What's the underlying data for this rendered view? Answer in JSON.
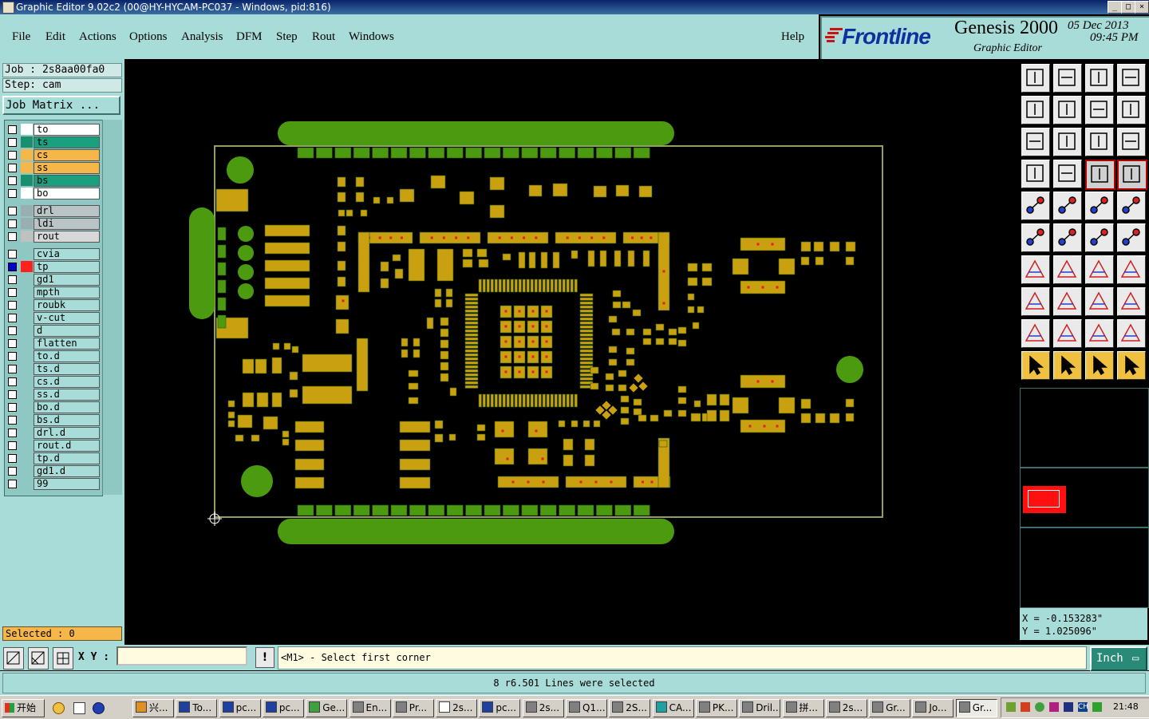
{
  "window": {
    "title": "Graphic Editor 9.02c2 (00@HY-HYCAM-PC037 - Windows, pid:816)",
    "controls": [
      "_",
      "□",
      "×"
    ]
  },
  "menu": [
    "File",
    "Edit",
    "Actions",
    "Options",
    "Analysis",
    "DFM",
    "Step",
    "Rout",
    "Windows"
  ],
  "help": "Help",
  "brand": {
    "logo": "Frontline",
    "product": "Genesis 2000",
    "subtitle": "Graphic Editor",
    "date": "05 Dec 2013",
    "time": "09:45 PM"
  },
  "job": {
    "job_line": "Job : 2s8aa00fa0",
    "step_line": "Step: cam",
    "matrix_button": "Job Matrix ..."
  },
  "layers": [
    {
      "name": "to",
      "color": "#ffffff",
      "name_bg": "#ffffff"
    },
    {
      "name": "ts",
      "color": "#1a8f6f",
      "name_bg": "#1a9f7f"
    },
    {
      "name": "cs",
      "color": "#f5b64a",
      "name_bg": "#f5b64a"
    },
    {
      "name": "ss",
      "color": "#f5b64a",
      "name_bg": "#f5b64a"
    },
    {
      "name": "bs",
      "color": "#1a8f6f",
      "name_bg": "#1a9f7f"
    },
    {
      "name": "bo",
      "color": "#ffffff",
      "name_bg": "#ffffff"
    },
    {
      "name": "drl",
      "color": "#9aaeb0",
      "name_bg": "#b8c4c6"
    },
    {
      "name": "ldi",
      "color": "#9aaeb0",
      "name_bg": "#b8c4c6"
    },
    {
      "name": "rout",
      "color": "#c0c0c0",
      "name_bg": "#d8d8d8"
    },
    {
      "name": "cvia",
      "color": "#8fc7c3",
      "name_bg": "#a7dcd8"
    },
    {
      "name": "tp",
      "color": "#ff2020",
      "name_bg": "#a7dcd8"
    },
    {
      "name": "gd1",
      "color": "#8fc7c3",
      "name_bg": "#a7dcd8"
    },
    {
      "name": "mpth",
      "color": "#8fc7c3",
      "name_bg": "#a7dcd8"
    },
    {
      "name": "roubk",
      "color": "#8fc7c3",
      "name_bg": "#a7dcd8"
    },
    {
      "name": "v-cut",
      "color": "#8fc7c3",
      "name_bg": "#a7dcd8"
    },
    {
      "name": "d",
      "color": "#8fc7c3",
      "name_bg": "#a7dcd8"
    },
    {
      "name": "flatten",
      "color": "#8fc7c3",
      "name_bg": "#a7dcd8"
    },
    {
      "name": "to.d",
      "color": "#8fc7c3",
      "name_bg": "#a7dcd8"
    },
    {
      "name": "ts.d",
      "color": "#8fc7c3",
      "name_bg": "#a7dcd8"
    },
    {
      "name": "cs.d",
      "color": "#8fc7c3",
      "name_bg": "#a7dcd8"
    },
    {
      "name": "ss.d",
      "color": "#8fc7c3",
      "name_bg": "#a7dcd8"
    },
    {
      "name": "bo.d",
      "color": "#8fc7c3",
      "name_bg": "#a7dcd8"
    },
    {
      "name": "bs.d",
      "color": "#8fc7c3",
      "name_bg": "#a7dcd8"
    },
    {
      "name": "drl.d",
      "color": "#8fc7c3",
      "name_bg": "#a7dcd8"
    },
    {
      "name": "rout.d",
      "color": "#8fc7c3",
      "name_bg": "#a7dcd8"
    },
    {
      "name": "tp.d",
      "color": "#8fc7c3",
      "name_bg": "#a7dcd8"
    },
    {
      "name": "gd1.d",
      "color": "#8fc7c3",
      "name_bg": "#a7dcd8"
    },
    {
      "name": "99",
      "color": "#8fc7c3",
      "name_bg": "#a7dcd8"
    }
  ],
  "selected": "Selected : 0",
  "coords": {
    "x": "X = -0.153283\"",
    "y": "Y = 1.025096\""
  },
  "xy_label": "X Y :",
  "xy_value": "",
  "prompt": "<M1> - Select first corner",
  "units": "Inch",
  "status": "8 r6.501 Lines were selected",
  "taskbar": {
    "start": "开始",
    "tasks": [
      "兴...",
      "To...",
      "pc...",
      "pc...",
      "Ge...",
      "En...",
      "Pr...",
      "2s...",
      "pc...",
      "2s...",
      "Q1...",
      "2S...",
      "CA...",
      "PK...",
      "Dril...",
      "拼...",
      "2s...",
      "Gr...",
      "Jo...",
      "Gr..."
    ],
    "clock": "21:48"
  },
  "tool_icons": [
    "fit-home-icon",
    "zoom-down-icon",
    "home-view-icon",
    "window-split-icon",
    "pan-left-icon",
    "pan-right-icon",
    "ratio-icon",
    "s-curve-icon",
    "zoom-fit-icon",
    "zoom-center-icon",
    "scale-1-2-icon",
    "help-query-icon",
    "settings-icon",
    "grid-icon",
    "snap-pad-icon",
    "snap-line-icon",
    "film-icon",
    "resize-icon",
    "ruler-icon",
    "filled-circle-icon",
    "net-icon",
    "cross-icon",
    "move-node-icon",
    "add-node-icon",
    "angle-icon",
    "line-icon",
    "arc-icon",
    "shape-icon",
    "select-area-icon",
    "minus-icon",
    "measure-icon",
    "feature-icon",
    "triangle-icon",
    "triangle-a-icon",
    "triangle-b-icon",
    "triangle-c-icon",
    "pointer-icon",
    "pointer-box-icon",
    "pointer-cross-icon",
    "route-icon"
  ]
}
